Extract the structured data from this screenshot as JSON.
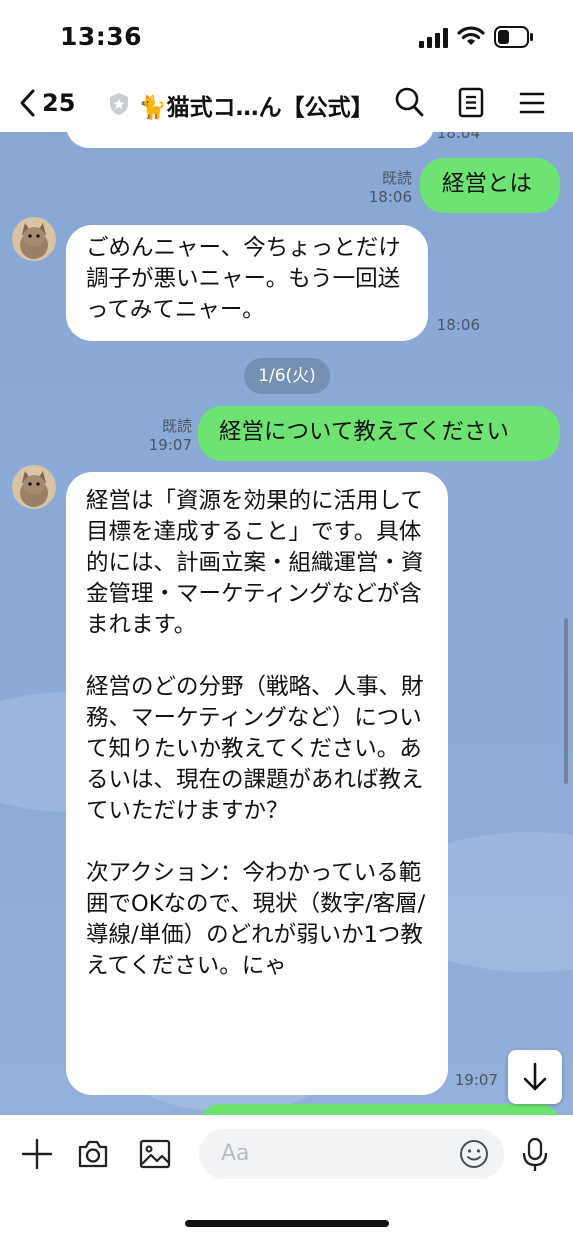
{
  "status_bar": {
    "time": "13:36"
  },
  "header": {
    "back_count": "25",
    "title": "🐈猫式コ…ん【公式】",
    "icons": [
      "search-icon",
      "notes-icon",
      "menu-icon"
    ]
  },
  "chat": {
    "top_partial_time": "18:04",
    "messages": [
      {
        "type": "outgoing",
        "text": "経営とは",
        "read": "既読",
        "time": "18:06"
      },
      {
        "type": "incoming",
        "text": "ごめんニャー、今ちょっとだけ調子が悪いニャー。もう一回送ってみてニャー。",
        "time": "18:06"
      },
      {
        "type": "date",
        "text": "1/6(火)"
      },
      {
        "type": "outgoing",
        "text": "経営について教えてください",
        "read": "既読",
        "time": "19:07"
      },
      {
        "type": "incoming",
        "text": "経営は「資源を効果的に活用して目標を達成すること」です。具体的には、計画立案・組織運営・資金管理・マーケティングなどが含まれます。\n\n経営のどの分野（戦略、人事、財務、マーケティングなど）について知りたいか教えてください。あるいは、現在の課題があれば教えていただけますか？\n\n次アクション：今わかっている範囲でOKなので、現状（数字/客層/導線/単価）のどれが弱いか1つ教えてください。にゃ",
        "time": "19:07"
      }
    ]
  },
  "input": {
    "placeholder": "Aa"
  },
  "colors": {
    "chat_bg": "#8aa8d6",
    "outgoing_bubble": "#6de372",
    "incoming_bubble": "#ffffff"
  }
}
